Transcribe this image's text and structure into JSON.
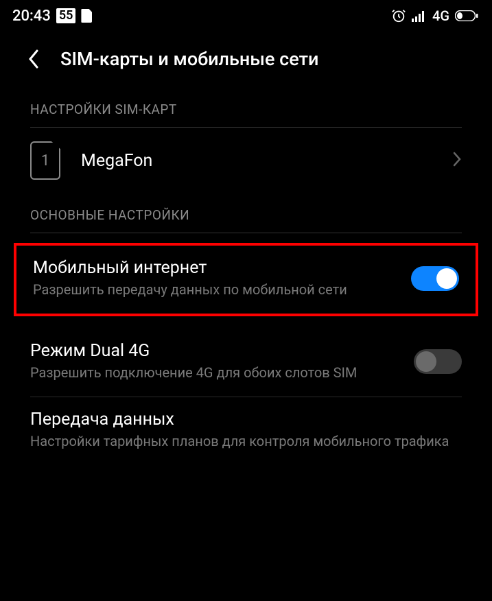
{
  "statusbar": {
    "time": "20:43",
    "badge": "55",
    "network": "4G"
  },
  "header": {
    "title": "SIM-карты и мобильные сети"
  },
  "section1": {
    "header": "НАСТРОЙКИ SIM-КАРТ",
    "sim": {
      "slot": "1",
      "name": "MegaFon"
    }
  },
  "section2": {
    "header": "ОСНОВНЫЕ НАСТРОЙКИ",
    "items": [
      {
        "title": "Мобильный интернет",
        "subtitle": "Разрешить передачу данных по мобильной сети"
      },
      {
        "title": "Режим Dual 4G",
        "subtitle": "Разрешить подключение 4G для обоих слотов SIM"
      },
      {
        "title": "Передача данных",
        "subtitle": "Настройки тарифных планов для контроля мобильного трафика"
      }
    ]
  }
}
